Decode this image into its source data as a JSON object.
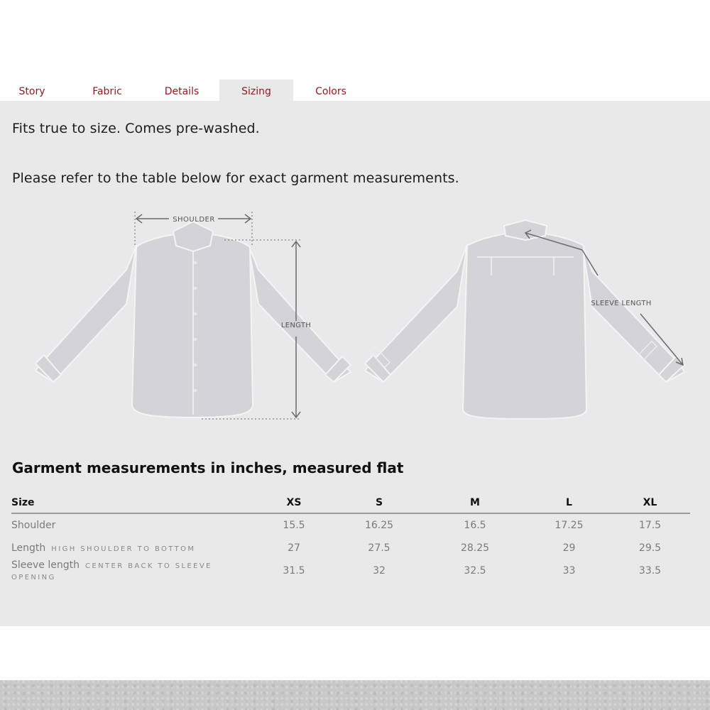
{
  "tabs": [
    {
      "label": "Story",
      "active": false
    },
    {
      "label": "Fabric",
      "active": false
    },
    {
      "label": "Details",
      "active": false
    },
    {
      "label": "Sizing",
      "active": true
    },
    {
      "label": "Colors",
      "active": false
    }
  ],
  "intro": {
    "line1": "Fits true to size. Comes pre-washed.",
    "line2": "Please refer to the table below for exact garment measurements."
  },
  "diagram": {
    "shoulder_label": "SHOULDER",
    "length_label": "LENGTH",
    "sleeve_label": "SLEEVE LENGTH"
  },
  "table": {
    "title": "Garment measurements in inches, measured flat",
    "headers": [
      "Size",
      "XS",
      "S",
      "M",
      "L",
      "XL"
    ],
    "rows": [
      {
        "label": "Shoulder",
        "hint": "",
        "values": [
          "15.5",
          "16.25",
          "16.5",
          "17.25",
          "17.5"
        ]
      },
      {
        "label": "Length",
        "hint": "HIGH SHOULDER TO BOTTOM",
        "values": [
          "27",
          "27.5",
          "28.25",
          "29",
          "29.5"
        ]
      },
      {
        "label": "Sleeve length",
        "hint": "CENTER BACK TO SLEEVE OPENING",
        "values": [
          "31.5",
          "32",
          "32.5",
          "33",
          "33.5"
        ]
      }
    ]
  },
  "colors": {
    "accent": "#8d1b1b",
    "panel": "#e9e9e9",
    "shirt": "#d3d3d8"
  }
}
